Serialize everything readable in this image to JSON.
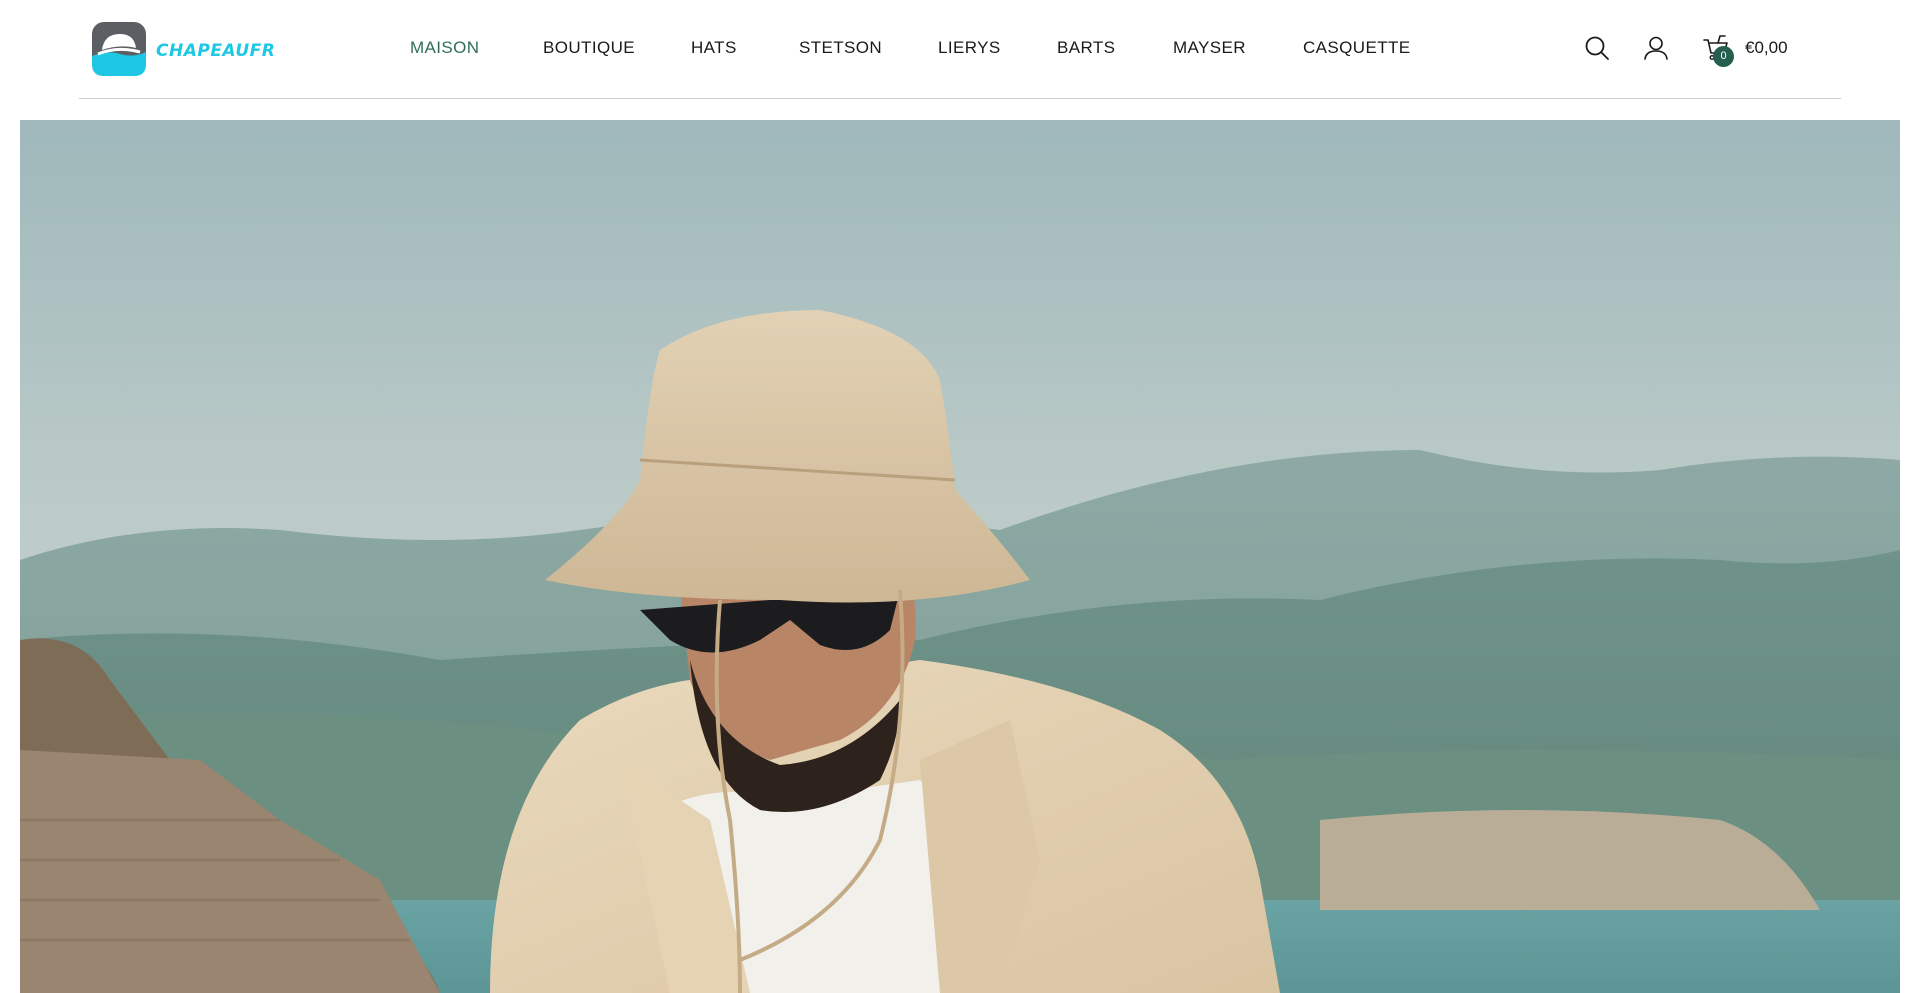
{
  "site": {
    "brand": "CHAPEAUFR",
    "accent_color": "#1ec8e4",
    "active_color": "#2f6d5d"
  },
  "nav": {
    "items": [
      {
        "label": "MAISON",
        "active": true
      },
      {
        "label": "BOUTIQUE",
        "active": false
      },
      {
        "label": "HATS",
        "active": false
      },
      {
        "label": "STETSON",
        "active": false
      },
      {
        "label": "LIERYS",
        "active": false
      },
      {
        "label": "BARTS",
        "active": false
      },
      {
        "label": "MAYSER",
        "active": false
      },
      {
        "label": "CASQUETTE",
        "active": false
      }
    ]
  },
  "header_actions": {
    "search_icon": "search-icon",
    "account_icon": "user-icon",
    "cart_icon": "cart-icon",
    "cart_count": "0",
    "cart_total": "€0,00"
  },
  "hero": {
    "image": "man-in-bucket-hat-landscape"
  }
}
